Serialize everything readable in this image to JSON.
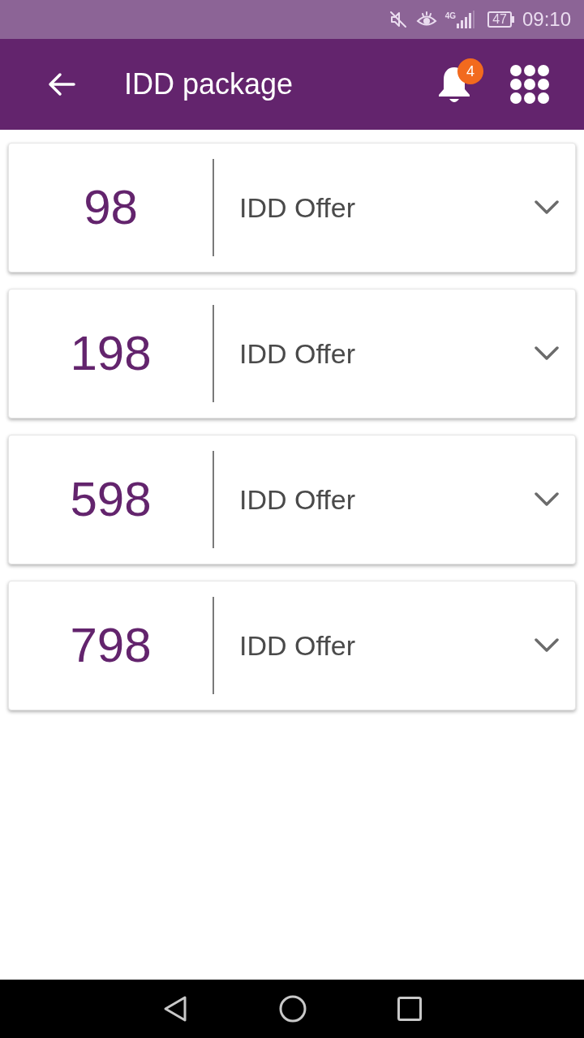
{
  "status_bar": {
    "network": "4G",
    "battery": "47",
    "time": "09:10"
  },
  "header": {
    "title": "IDD package",
    "notification_count": "4"
  },
  "packages": [
    {
      "amount": "98",
      "name": "IDD Offer",
      "expanded": false
    },
    {
      "amount": "198",
      "name": "IDD Offer",
      "expanded": false
    },
    {
      "amount": "598",
      "name": "IDD Offer",
      "expanded": false
    },
    {
      "amount": "798",
      "name": "IDD Offer",
      "expanded": false
    }
  ]
}
